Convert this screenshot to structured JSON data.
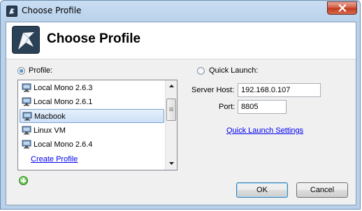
{
  "window": {
    "title": "Choose Profile"
  },
  "header": {
    "title": "Choose Profile"
  },
  "profile": {
    "radio_label": "Profile:",
    "selected": true,
    "items": [
      {
        "label": "Local Mono 2.6.3",
        "selected": false
      },
      {
        "label": "Local Mono 2.6.1",
        "selected": false
      },
      {
        "label": "Macbook",
        "selected": true
      },
      {
        "label": "Linux VM",
        "selected": false
      },
      {
        "label": "Local Mono 2.6.4",
        "selected": false
      }
    ],
    "create_link": "Create Profile"
  },
  "quick_launch": {
    "radio_label": "Quick Launch:",
    "selected": false,
    "server_host_label": "Server Host:",
    "server_host_value": "192.168.0.107",
    "port_label": "Port:",
    "port_value": "8805",
    "settings_link": "Quick Launch Settings"
  },
  "buttons": {
    "ok": "OK",
    "cancel": "Cancel"
  },
  "icons": {
    "title": "profile-app-icon",
    "header": "profile-app-logo",
    "list_item": "monitor-icon",
    "create": "add-icon",
    "close": "close-icon"
  },
  "colors": {
    "selection_bg": "#cde1f7",
    "selection_border": "#7da2ce",
    "link": "#0000ee",
    "close_button": "#c03a1d"
  }
}
